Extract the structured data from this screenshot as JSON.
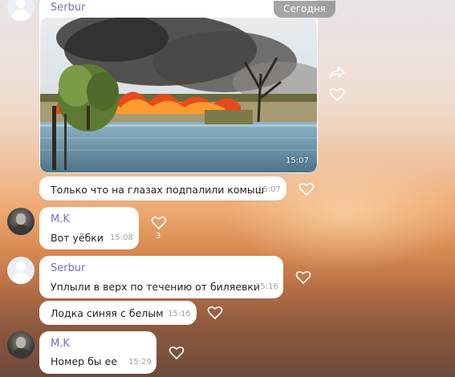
{
  "date_chip": "Сегодня",
  "messages": [
    {
      "sender": "Serbur",
      "image_time": "15:07",
      "text": "Только что на глазах подпалили комыш",
      "time": "15:07"
    },
    {
      "sender": "M.K",
      "text": "Вот уёбки",
      "time": "15:08",
      "likes": "3"
    },
    {
      "sender": "Serbur",
      "text": "Уплыли в верх по течению от биляевки",
      "time": "15:16"
    },
    {
      "text": "Лодка синяя с белым",
      "time": "15:16"
    },
    {
      "sender": "M.K",
      "text": "Номер бы ее",
      "time": "15:29"
    }
  ],
  "icons": {
    "share": "share-icon",
    "like": "heart-icon"
  },
  "colors": {
    "sender_name": "#7b6bc1",
    "bubble": "#ffffff",
    "time": "#a2a2a2"
  }
}
